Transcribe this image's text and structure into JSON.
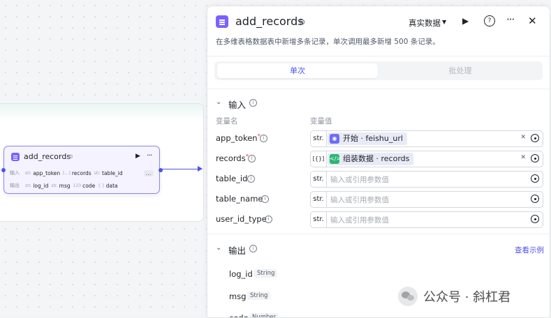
{
  "canvas": {
    "node": {
      "title": "add_records",
      "badge": "⊜",
      "input_label": "输入",
      "output_label": "输出",
      "inputs": [
        {
          "type": "str.",
          "name": "app_token"
        },
        {
          "type": "[…]",
          "name": "records"
        },
        {
          "type": "str.",
          "name": "table_id"
        }
      ],
      "inputs_more": "…",
      "outputs": [
        {
          "type": "str.",
          "name": "log_id"
        },
        {
          "type": "str.",
          "name": "msg"
        },
        {
          "type": "123",
          "name": "code"
        },
        {
          "type": "{ }",
          "name": "data"
        }
      ]
    }
  },
  "panel": {
    "title": "add_records",
    "title_badge": "⊜",
    "mode_selector": "真实数据",
    "description": "在多维表格数据表中新增多条记录，单次调用最多新增 500 条记录。",
    "tabs": {
      "single": "单次",
      "batch": "批处理"
    },
    "input_section": {
      "title": "输入",
      "col_name": "变量名",
      "col_value": "变量值",
      "rows": [
        {
          "name": "app_token",
          "required": "*",
          "type": "str.",
          "ref_node": "开始",
          "ref_var": "feishu_url",
          "ref_color": "#6e6cf6"
        },
        {
          "name": "records",
          "required": "*",
          "type": "[{}]",
          "ref_node": "组装数据",
          "ref_var": "records",
          "ref_color": "#2bb673"
        },
        {
          "name": "table_id",
          "required": "",
          "type": "str.",
          "placeholder": "输入或引用参数值"
        },
        {
          "name": "table_name",
          "required": "",
          "type": "str.",
          "placeholder": "输入或引用参数值"
        },
        {
          "name": "user_id_type",
          "required": "",
          "type": "str.",
          "placeholder": "输入或引用参数值"
        }
      ]
    },
    "output_section": {
      "title": "输出",
      "example_link": "查看示例",
      "items": [
        {
          "name": "log_id",
          "type": "String"
        },
        {
          "name": "msg",
          "type": "String"
        },
        {
          "name": "code",
          "type": "Number"
        }
      ]
    }
  },
  "watermark": {
    "text": "公众号 · 斜杠君"
  },
  "colors": {
    "accent": "#4d53e8",
    "node_icon": "#7b61ff",
    "required": "#f54a45"
  }
}
